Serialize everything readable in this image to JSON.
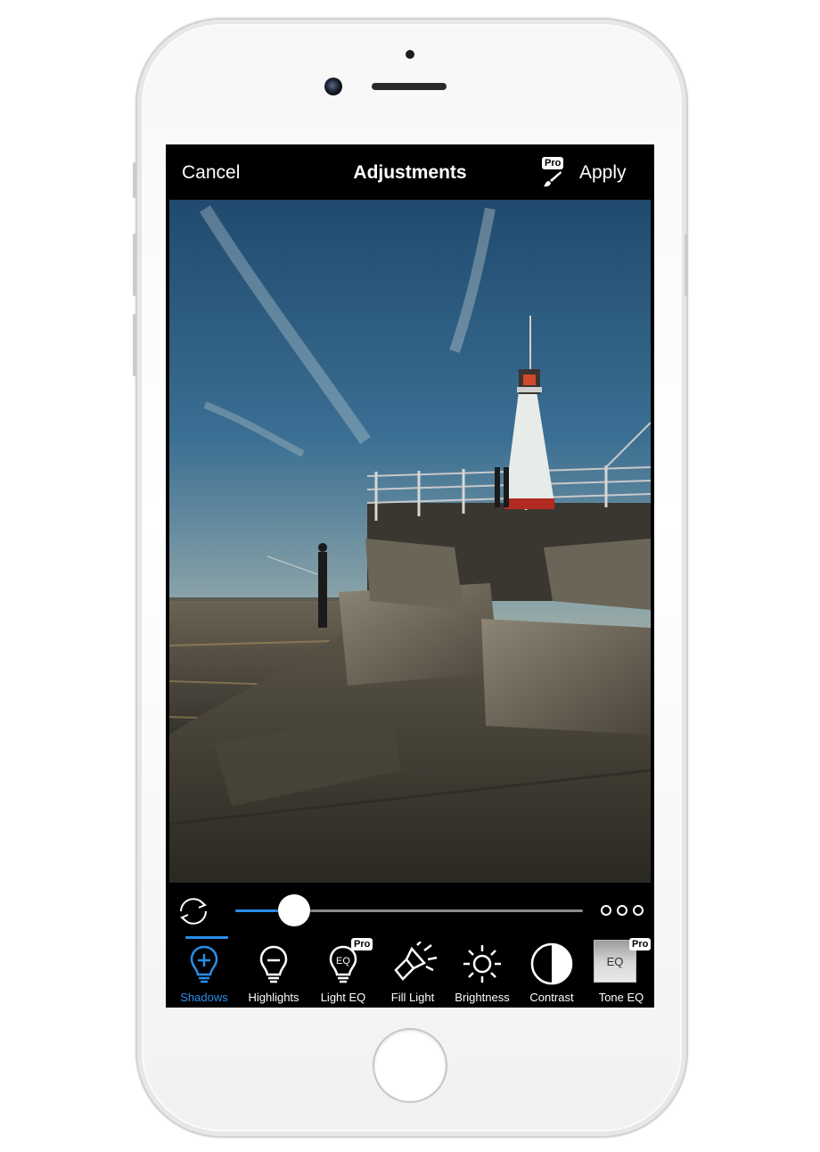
{
  "header": {
    "cancel_label": "Cancel",
    "title": "Adjustments",
    "apply_label": "Apply",
    "pro_badge": "Pro"
  },
  "slider": {
    "value": 0.17
  },
  "icons": {
    "reset": "refresh-icon",
    "more": "more-options-icon"
  },
  "tools": [
    {
      "label": "Shadows",
      "icon": "bulb-plus-icon",
      "active": true
    },
    {
      "label": "Highlights",
      "icon": "bulb-minus-icon",
      "active": false
    },
    {
      "label": "Light EQ",
      "icon": "bulb-eq-icon",
      "badge": "Pro",
      "icon_text": "EQ",
      "active": false
    },
    {
      "label": "Fill Light",
      "icon": "flashlight-icon",
      "active": false
    },
    {
      "label": "Brightness",
      "icon": "sun-icon",
      "active": false
    },
    {
      "label": "Contrast",
      "icon": "contrast-icon",
      "active": false
    },
    {
      "label": "Tone EQ",
      "icon": "tone-eq-icon",
      "badge": "Pro",
      "icon_text": "EQ",
      "active": false
    }
  ],
  "colors": {
    "accent": "#2a8de8",
    "bar": "#000000",
    "text": "#ffffff"
  }
}
